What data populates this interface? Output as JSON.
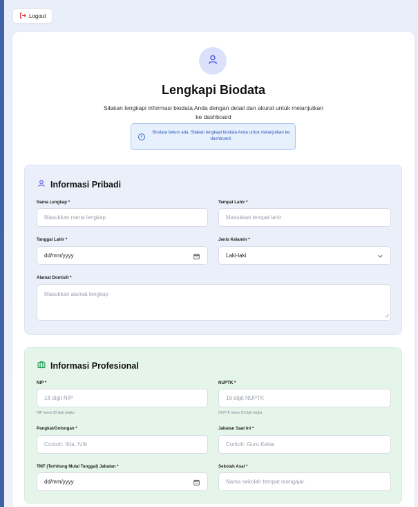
{
  "header": {
    "logout_label": "Logout"
  },
  "intro": {
    "title": "Lengkapi Biodata",
    "subtitle": "Silakan lengkapi informasi biodata Anda dengan detail dan akurat untuk melanjutkan ke dashboard",
    "alert": "Biodata belum ada. Silakan lengkapi biodata Anda untuk melanjutkan ke dashboard."
  },
  "personal": {
    "heading": "Informasi Pribadi",
    "nama_label": "Nama Lengkap *",
    "nama_placeholder": "Masukkan nama lengkap",
    "tempat_label": "Tempat Lahir *",
    "tempat_placeholder": "Masukkan tempat lahir",
    "tanggal_label": "Tanggal Lahir *",
    "tanggal_value": "dd/mm/yyyy",
    "jk_label": "Jenis Kelamin *",
    "jk_value": "Laki-laki",
    "alamat_label": "Alamat Domisili *",
    "alamat_placeholder": "Masukkan alamat lengkap"
  },
  "professional": {
    "heading": "Informasi Profesional",
    "nip_label": "NIP *",
    "nip_placeholder": "18 digit NIP",
    "nip_hint": "NIP harus 18 digit angka",
    "nuptk_label": "NUPTK *",
    "nuptk_placeholder": "16 digit NUPTK",
    "nuptk_hint": "NUPTK harus 18 digit angka",
    "pangkat_label": "Pangkat/Golongan *",
    "pangkat_placeholder": "Contoh: III/a, IV/b",
    "jabatan_label": "Jabatan Saat Ini *",
    "jabatan_placeholder": "Contoh: Guru Kelas",
    "tmt_label": "TMT (Terhitung Mulai Tanggal) Jabatan *",
    "tmt_value": "dd/mm/yyyy",
    "sekolah_label": "Sekolah Asal *",
    "sekolah_placeholder": "Nama sekolah tempat mengajar"
  },
  "icons": {
    "logout": "logout-icon",
    "avatar": "user-icon",
    "info": "info-icon",
    "personal": "user-icon",
    "professional": "briefcase-icon",
    "calendar": "calendar-icon",
    "select": "chevron-down-icon"
  },
  "colors": {
    "accent": "#4a57e8",
    "logout_icon": "#e23b3b",
    "alert_bg": "#e7f0fd",
    "alert_text": "#2b55b8",
    "personal_bg": "#eaeff9",
    "professional_bg": "#e6f5ea",
    "professional_icon": "#1f9a4c"
  }
}
